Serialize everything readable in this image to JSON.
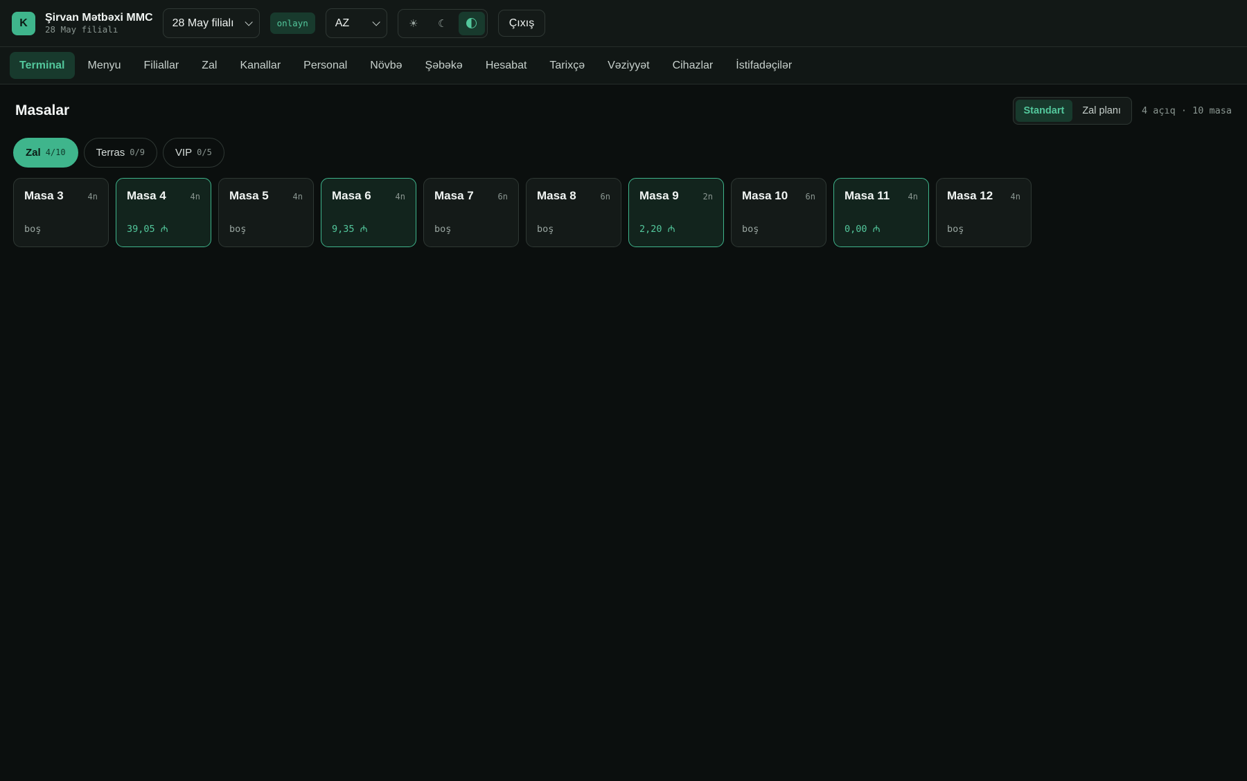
{
  "header": {
    "logo_letter": "K",
    "company": "Şirvan Mətbəxi MMC",
    "branch_sub": "28 May filialı",
    "branch_select": "28 May filialı",
    "status": "onlayn",
    "language": "AZ",
    "logout": "Çıxış"
  },
  "nav": {
    "items": [
      {
        "label": "Terminal"
      },
      {
        "label": "Menyu"
      },
      {
        "label": "Filiallar"
      },
      {
        "label": "Zal"
      },
      {
        "label": "Kanallar"
      },
      {
        "label": "Personal"
      },
      {
        "label": "Növbə"
      },
      {
        "label": "Şəbəkə"
      },
      {
        "label": "Hesabat"
      },
      {
        "label": "Tarixçə"
      },
      {
        "label": "Vəziyyət"
      },
      {
        "label": "Cihazlar"
      },
      {
        "label": "İstifadəçilər"
      }
    ],
    "active_index": 0
  },
  "main": {
    "title": "Masalar",
    "views": [
      {
        "label": "Standart"
      },
      {
        "label": "Zal planı"
      }
    ],
    "summary": "4 açıq · 10 masa",
    "zones": [
      {
        "label": "Zal",
        "count": "4/10"
      },
      {
        "label": "Terras",
        "count": "0/9"
      },
      {
        "label": "VIP",
        "count": "0/5"
      }
    ],
    "tables": [
      {
        "name": "Masa 3",
        "seats": "4n",
        "status": "boş",
        "occupied": false
      },
      {
        "name": "Masa 4",
        "seats": "4n",
        "status": "39,05 ₼",
        "occupied": true
      },
      {
        "name": "Masa 5",
        "seats": "4n",
        "status": "boş",
        "occupied": false
      },
      {
        "name": "Masa 6",
        "seats": "4n",
        "status": "9,35 ₼",
        "occupied": true
      },
      {
        "name": "Masa 7",
        "seats": "6n",
        "status": "boş",
        "occupied": false
      },
      {
        "name": "Masa 8",
        "seats": "6n",
        "status": "boş",
        "occupied": false
      },
      {
        "name": "Masa 9",
        "seats": "2n",
        "status": "2,20 ₼",
        "occupied": true
      },
      {
        "name": "Masa 10",
        "seats": "6n",
        "status": "boş",
        "occupied": false
      },
      {
        "name": "Masa 11",
        "seats": "4n",
        "status": "0,00 ₼",
        "occupied": true
      },
      {
        "name": "Masa 12",
        "seats": "4n",
        "status": "boş",
        "occupied": false
      }
    ]
  },
  "icons": {
    "light": "sun-icon",
    "dark": "moon-icon",
    "auto": "contrast-icon"
  },
  "colors": {
    "accent": "#3fb58c",
    "background": "#0b0f0e",
    "panel": "#121816"
  }
}
